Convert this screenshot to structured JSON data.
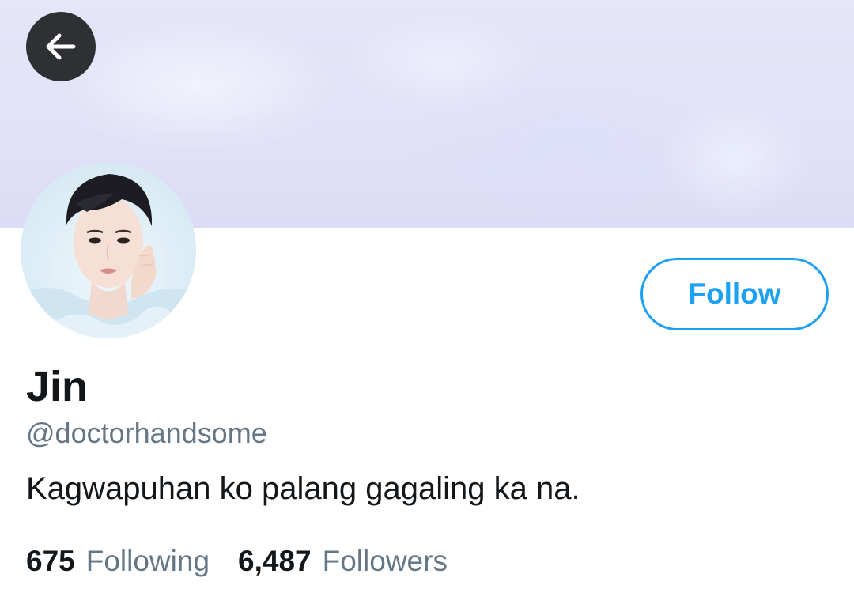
{
  "header": {
    "back_icon": "arrow-left-icon",
    "banner_colors": [
      "#e6e6fa",
      "#dcdcf6"
    ],
    "back_button_color": "#2f3033"
  },
  "profile": {
    "display_name": "Jin",
    "handle": "@doctorhandsome",
    "bio": "Kagwapuhan ko palang gagaling ka na.",
    "follow_label": "Follow",
    "accent_color": "#1da1f2"
  },
  "stats": {
    "following_count": "675",
    "following_label": "Following",
    "followers_count": "6,487",
    "followers_label": "Followers"
  }
}
